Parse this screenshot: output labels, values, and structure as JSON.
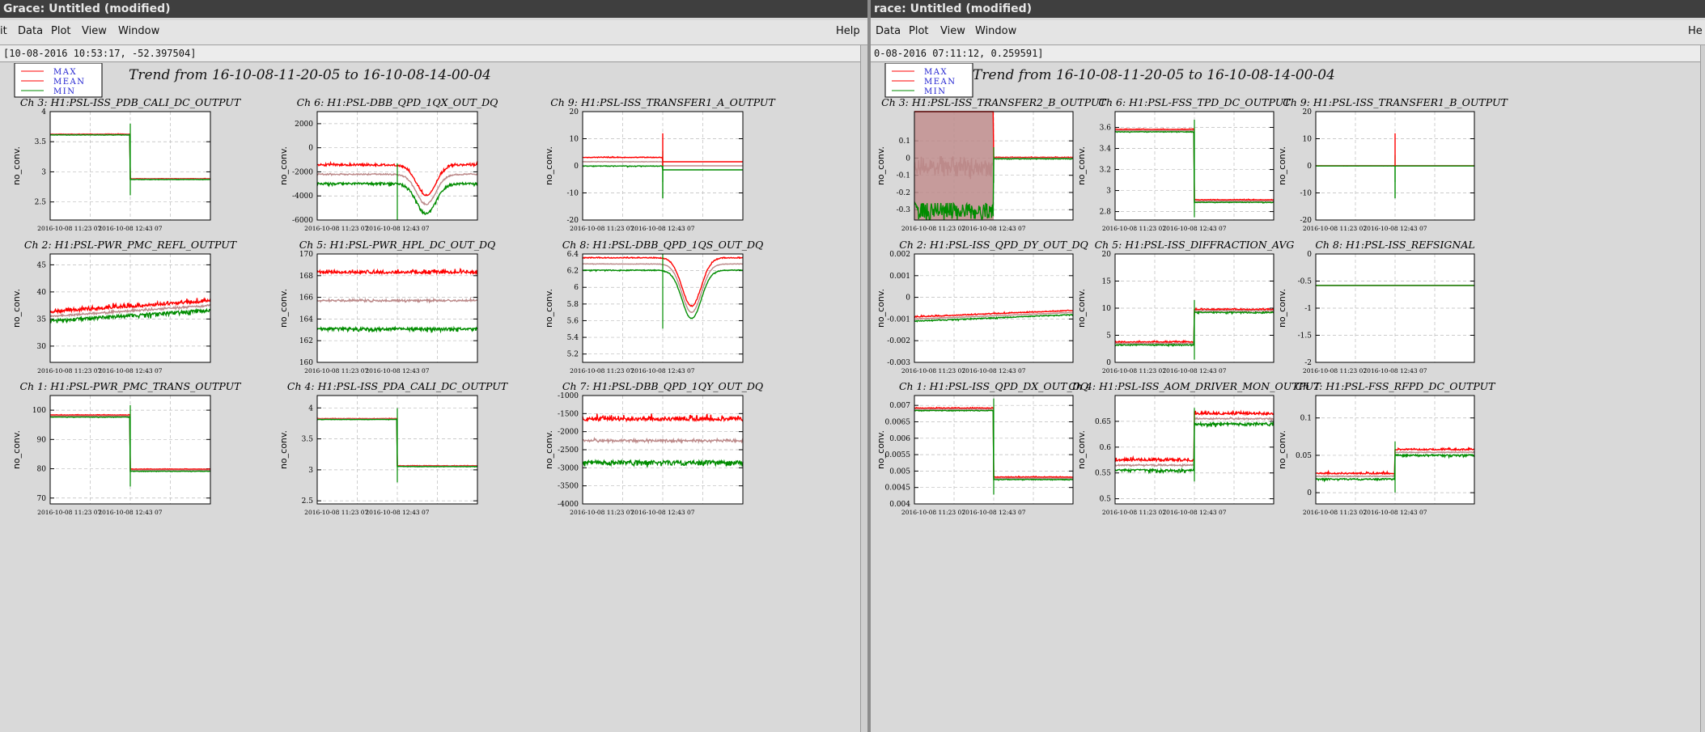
{
  "windows": [
    {
      "id": "left",
      "title": "Grace: Untitled (modified)",
      "status": "[10-08-2016 10:53:17, -52.397504]",
      "menus": [
        "it",
        "Data",
        "Plot",
        "View",
        "Window"
      ],
      "help": "Help",
      "legend": [
        "MAX",
        "MEAN",
        "MIN"
      ],
      "trend_title": "Trend from 16-10-08-11-20-05 to 16-10-08-14-00-04"
    },
    {
      "id": "right",
      "title": "race: Untitled (modified)",
      "status": "0-08-2016 07:11:12, 0.259591]",
      "menus": [
        "Data",
        "Plot",
        "View",
        "Window"
      ],
      "help": "He",
      "legend": [
        "MAX",
        "MEAN",
        "MIN"
      ],
      "trend_title": "Trend from 16-10-08-11-20-05 to 16-10-08-14-00-04"
    }
  ],
  "colors": {
    "max": "#ff0000",
    "mean": "#bc8a8a",
    "min": "#008c00",
    "grid": "#bbbbbb"
  },
  "chart_data": [
    {
      "type": "line",
      "window": "left",
      "col": 0,
      "row": 0,
      "title": "Ch 3: H1:PSL-ISS_PDB_CALI_DC_OUTPUT",
      "ylabel": "no_conv.",
      "yticks": [
        "4",
        "3.5",
        "3",
        "2.5"
      ],
      "ylim": [
        2.2,
        4.0
      ],
      "xticks": [
        "2016-10-08 11:23 07",
        "2016-10-08 12:43 07"
      ],
      "profile": "stepdown",
      "levels": [
        3.62,
        2.88
      ],
      "noise": 0.01,
      "band": 0.005
    },
    {
      "type": "line",
      "window": "left",
      "col": 1,
      "row": 0,
      "title": "Ch 6: H1:PSL-DBB_QPD_1QX_OUT_DQ",
      "ylabel": "no_conv.",
      "yticks": [
        "2000",
        "0",
        "-2000",
        "-4000",
        "-6000"
      ],
      "ylim": [
        -6000,
        3000
      ],
      "xticks": [
        "2016-10-08 11:23 07",
        "2016-10-08 12:43 07"
      ],
      "profile": "dip",
      "levels": [
        -2200,
        -4700
      ],
      "noise": 350,
      "band": 700
    },
    {
      "type": "line",
      "window": "left",
      "col": 2,
      "row": 0,
      "title": "Ch 9: H1:PSL-ISS_TRANSFER1_A_OUTPUT",
      "ylabel": "no_conv.",
      "yticks": [
        "20",
        "10",
        "0",
        "-10",
        "-20"
      ],
      "ylim": [
        -20,
        20
      ],
      "xticks": [
        "2016-10-08 11:23 07",
        "2016-10-08 12:43 07"
      ],
      "profile": "flatcut",
      "levels": [
        1.5,
        0.0
      ],
      "noise": 0.5,
      "band": 1.5
    },
    {
      "type": "line",
      "window": "left",
      "col": 0,
      "row": 1,
      "title": "Ch 2: H1:PSL-PWR_PMC_REFL_OUTPUT",
      "ylabel": "no_conv.",
      "yticks": [
        "45",
        "40",
        "35",
        "30"
      ],
      "ylim": [
        27,
        47
      ],
      "xticks": [
        "2016-10-08 11:23 07",
        "2016-10-08 12:43 07"
      ],
      "profile": "noisyrise",
      "levels": [
        35.5,
        37.5
      ],
      "noise": 1.2,
      "band": 0.6
    },
    {
      "type": "line",
      "window": "left",
      "col": 1,
      "row": 1,
      "title": "Ch 5: H1:PSL-PWR_HPL_DC_OUT_DQ",
      "ylabel": "no_conv.",
      "yticks": [
        "170",
        "168",
        "166",
        "164",
        "162",
        "160"
      ],
      "ylim": [
        160,
        170
      ],
      "xticks": [
        "2016-10-08 11:23 07",
        "2016-10-08 12:43 07"
      ],
      "profile": "flat",
      "levels": [
        165.7,
        165.7
      ],
      "noise": 0.6,
      "band": 2.5
    },
    {
      "type": "line",
      "window": "left",
      "col": 2,
      "row": 1,
      "title": "Ch 8: H1:PSL-DBB_QPD_1QS_OUT_DQ",
      "ylabel": "no_conv.",
      "yticks": [
        "6.4",
        "6.2",
        "6",
        "5.8",
        "5.6",
        "5.4",
        "5.2"
      ],
      "ylim": [
        5.1,
        6.4
      ],
      "xticks": [
        "2016-10-08 11:23 07",
        "2016-10-08 12:43 07"
      ],
      "profile": "dip",
      "levels": [
        6.28,
        5.7
      ],
      "noise": 0.02,
      "band": 0.07
    },
    {
      "type": "line",
      "window": "left",
      "col": 0,
      "row": 2,
      "title": "Ch 1: H1:PSL-PWR_PMC_TRANS_OUTPUT",
      "ylabel": "no_conv.",
      "yticks": [
        "100",
        "90",
        "80",
        "70"
      ],
      "ylim": [
        68,
        105
      ],
      "xticks": [
        "2016-10-08 11:23 07",
        "2016-10-08 12:43 07"
      ],
      "profile": "stepdown",
      "levels": [
        98,
        79.5
      ],
      "noise": 0.3,
      "band": 0.3
    },
    {
      "type": "line",
      "window": "left",
      "col": 1,
      "row": 2,
      "title": "Ch 4: H1:PSL-ISS_PDA_CALI_DC_OUTPUT",
      "ylabel": "no_conv.",
      "yticks": [
        "4",
        "3.5",
        "3",
        "2.5"
      ],
      "ylim": [
        2.45,
        4.2
      ],
      "xticks": [
        "2016-10-08 11:23 07",
        "2016-10-08 12:43 07"
      ],
      "profile": "stepdown",
      "levels": [
        3.82,
        3.06
      ],
      "noise": 0.01,
      "band": 0.005
    },
    {
      "type": "line",
      "window": "left",
      "col": 2,
      "row": 2,
      "title": "Ch 7: H1:PSL-DBB_QPD_1QY_OUT_DQ",
      "ylabel": "no_conv.",
      "yticks": [
        "-1000",
        "-1500",
        "-2000",
        "-2500",
        "-3000",
        "-3500",
        "-4000"
      ],
      "ylim": [
        -4000,
        -1000
      ],
      "xticks": [
        "2016-10-08 11:23 07",
        "2016-10-08 12:43 07"
      ],
      "profile": "flat",
      "levels": [
        -2250,
        -2250
      ],
      "noise": 250,
      "band": 550
    },
    {
      "type": "line",
      "window": "right",
      "col": 0,
      "row": 0,
      "title": "Ch 3: H1:PSL-ISS_TRANSFER2_B_OUTPUT",
      "ylabel": "no_conv.",
      "yticks": [
        "0.1",
        "0",
        "-0.1",
        "-0.2",
        "-0.3"
      ],
      "ylim": [
        -0.36,
        0.27
      ],
      "xticks": [
        "2016-10-08 11:23 07",
        "2016-10-08 12:43 07"
      ],
      "profile": "hugenoise",
      "levels": [
        -0.05,
        0.0
      ],
      "noise": 0.3,
      "band": 0.003
    },
    {
      "type": "line",
      "window": "right",
      "col": 1,
      "row": 0,
      "title": "Ch 6: H1:PSL-FSS_TPD_DC_OUTPUT",
      "ylabel": "no_conv.",
      "yticks": [
        "3.6",
        "3.4",
        "3.2",
        "3",
        "2.8"
      ],
      "ylim": [
        2.72,
        3.75
      ],
      "xticks": [
        "2016-10-08 11:23 07",
        "2016-10-08 12:43 07"
      ],
      "profile": "stepdown",
      "levels": [
        3.57,
        2.9
      ],
      "noise": 0.01,
      "band": 0.01
    },
    {
      "type": "line",
      "window": "right",
      "col": 2,
      "row": 0,
      "title": "Ch 9: H1:PSL-ISS_TRANSFER1_B_OUTPUT",
      "ylabel": "no_conv.",
      "yticks": [
        "20",
        "10",
        "0",
        "-10",
        "-20"
      ],
      "ylim": [
        -20,
        20
      ],
      "xticks": [
        "2016-10-08 11:23 07",
        "2016-10-08 12:43 07"
      ],
      "profile": "flatcut",
      "levels": [
        0,
        0
      ],
      "noise": 0.05,
      "band": 0.05
    },
    {
      "type": "line",
      "window": "right",
      "col": 0,
      "row": 1,
      "title": "Ch 2: H1:PSL-ISS_QPD_DY_OUT_DQ",
      "ylabel": "no_conv.",
      "yticks": [
        "0.002",
        "0.001",
        "0",
        "-0.001",
        "-0.002",
        "-0.003"
      ],
      "ylim": [
        -0.003,
        0.002
      ],
      "xticks": [
        "2016-10-08 11:23 07",
        "2016-10-08 12:43 07"
      ],
      "profile": "noisyrise",
      "levels": [
        -0.001,
        -0.0007
      ],
      "noise": 8e-05,
      "band": 8e-05
    },
    {
      "type": "line",
      "window": "right",
      "col": 1,
      "row": 1,
      "title": "Ch 5: H1:PSL-ISS_DIFFRACTION_AVG",
      "ylabel": "no_conv.",
      "yticks": [
        "20",
        "15",
        "10",
        "5",
        "0"
      ],
      "ylim": [
        0,
        20
      ],
      "xticks": [
        "2016-10-08 11:23 07",
        "2016-10-08 12:43 07"
      ],
      "profile": "stepup",
      "levels": [
        3.5,
        9.5
      ],
      "noise": 0.4,
      "band": 0.2
    },
    {
      "type": "line",
      "window": "right",
      "col": 2,
      "row": 1,
      "title": "Ch 8: H1:PSL-ISS_REFSIGNAL",
      "ylabel": "no_conv.",
      "yticks": [
        "0",
        "-0.5",
        "-1",
        "-1.5",
        "-2"
      ],
      "ylim": [
        -2,
        0
      ],
      "xticks": [
        "2016-10-08 11:23 07",
        "2016-10-08 12:43 07"
      ],
      "profile": "flat",
      "levels": [
        -0.58,
        -0.58
      ],
      "noise": 0.0,
      "band": 0.0
    },
    {
      "type": "line",
      "window": "right",
      "col": 0,
      "row": 2,
      "title": "Ch 1: H1:PSL-ISS_QPD_DX_OUT_DQ",
      "ylabel": "no_conv.",
      "yticks": [
        "0.007",
        "0.0065",
        "0.006",
        "0.0055",
        "0.005",
        "0.0045",
        "0.004"
      ],
      "ylim": [
        0.004,
        0.0073
      ],
      "xticks": [
        "2016-10-08 11:23 07",
        "2016-10-08 12:43 07"
      ],
      "profile": "stepdown",
      "levels": [
        0.00688,
        0.00478
      ],
      "noise": 4e-05,
      "band": 3e-05
    },
    {
      "type": "line",
      "window": "right",
      "col": 1,
      "row": 2,
      "title": "Ch 4: H1:PSL-ISS_AOM_DRIVER_MON_OUTPUT",
      "ylabel": "no_conv.",
      "yticks": [
        "0.65",
        "0.6",
        "0.55",
        "0.5"
      ],
      "ylim": [
        0.49,
        0.7
      ],
      "xticks": [
        "2016-10-08 11:23 07",
        "2016-10-08 12:43 07"
      ],
      "profile": "stepup",
      "levels": [
        0.565,
        0.655
      ],
      "noise": 0.01,
      "band": 0.008
    },
    {
      "type": "line",
      "window": "right",
      "col": 2,
      "row": 2,
      "title": "Ch 7: H1:PSL-FSS_RFPD_DC_OUTPUT",
      "ylabel": "no_conv.",
      "yticks": [
        "0.1",
        "0.05",
        "0"
      ],
      "ylim": [
        -0.015,
        0.13
      ],
      "xticks": [
        "2016-10-08 11:23 07",
        "2016-10-08 12:43 07"
      ],
      "profile": "stepup",
      "levels": [
        0.022,
        0.054
      ],
      "noise": 0.004,
      "band": 0.003
    }
  ]
}
